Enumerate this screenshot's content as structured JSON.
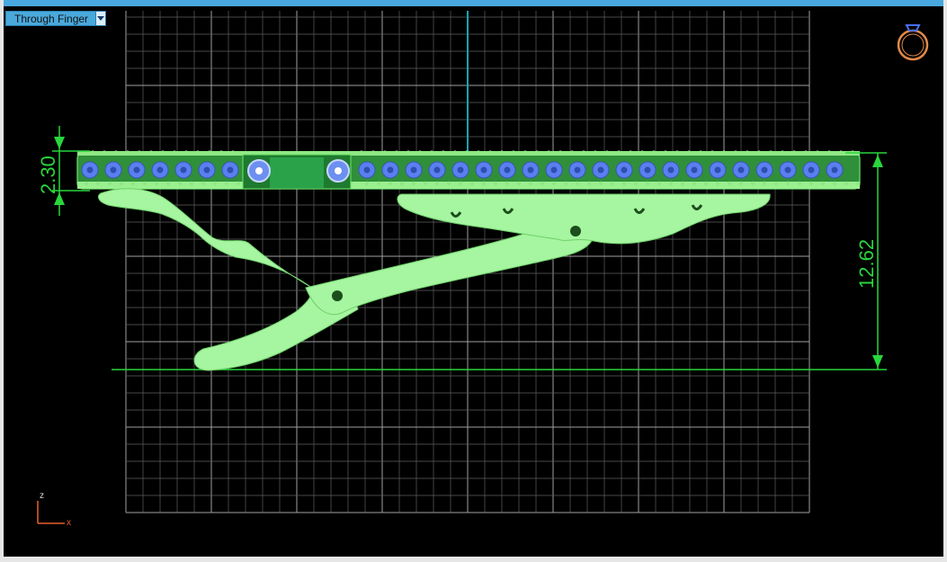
{
  "viewport": {
    "view_name": "Through Finger",
    "view_menu_icon": "dropdown-arrow-icon"
  },
  "dimensions": {
    "band_thickness": "2.30",
    "total_height": "12.62"
  },
  "axis_triad": {
    "vertical_axis": "z",
    "horizontal_axis": "x"
  },
  "icons": {
    "corner_widget": "ring-icon"
  },
  "colors": {
    "background": "#000000",
    "grid": "#8c8c8c",
    "dimension": "#29d63d",
    "model": "#a6f5a0",
    "gem": "#5a7ff0",
    "accent": "#48a8df",
    "ring_icon": "#e0894a",
    "axis_x": "#e8602c",
    "axis_z": "#e8602c"
  }
}
